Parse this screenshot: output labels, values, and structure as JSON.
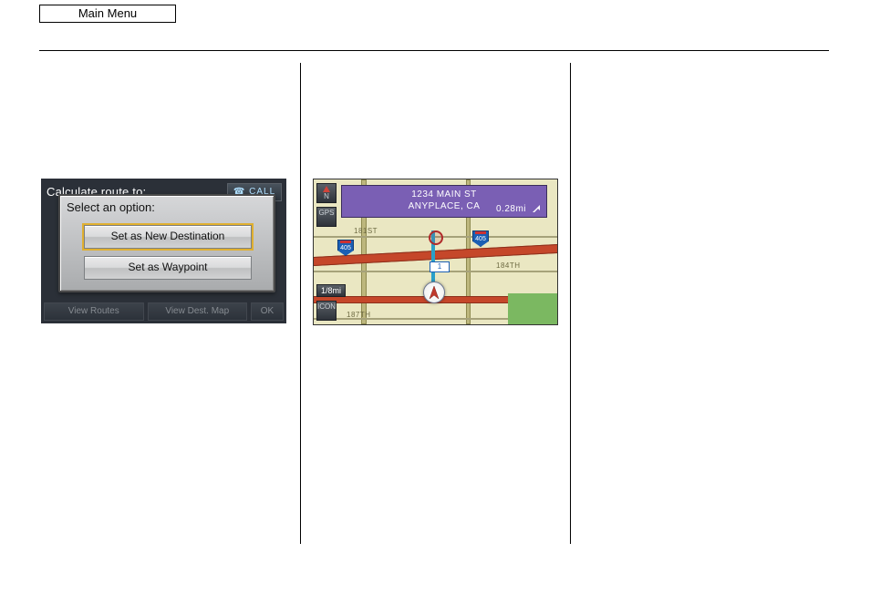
{
  "header": {
    "main_menu": "Main Menu"
  },
  "screenshot1": {
    "calc_label": "Calculate route to:",
    "call_label": "☎ CALL",
    "dialog": {
      "title": "Select an option:",
      "primary": "Set as New Destination",
      "secondary": "Set as Waypoint"
    },
    "bottom": {
      "view_routes": "View Routes",
      "view_dest_map": "View Dest. Map",
      "ok": "OK"
    }
  },
  "screenshot2": {
    "dest_address_line1": "1234 MAIN ST",
    "dest_address_line2": "ANYPLACE, CA",
    "distance": "0.28mi",
    "hwy_shield": "405",
    "street_181st": "181ST",
    "street_184th": "184TH",
    "street_187th": "187TH",
    "scale": "1/8mi",
    "compass_label": "N",
    "gps_label": "GPS",
    "icon_label": "ICON"
  }
}
